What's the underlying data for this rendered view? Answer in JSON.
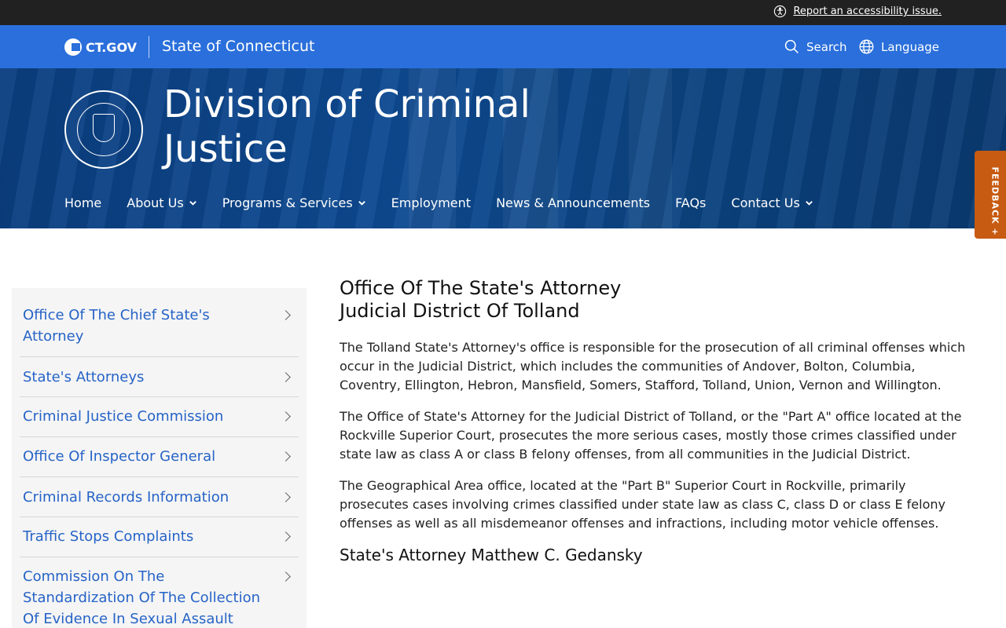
{
  "utility": {
    "accessibility_link": "Report an accessibility issue."
  },
  "ctbar": {
    "logo_text": "CT.GOV",
    "state_name": "State of Connecticut",
    "search_label": "Search",
    "language_label": "Language"
  },
  "hero": {
    "title_line1": "Division of Criminal",
    "title_line2": "Justice"
  },
  "nav": {
    "home": "Home",
    "about": "About Us",
    "programs": "Programs & Services",
    "employment": "Employment",
    "news": "News & Announcements",
    "faqs": "FAQs",
    "contact": "Contact Us"
  },
  "feedback": {
    "label": "FEEDBACK +"
  },
  "sidebar": {
    "items": [
      {
        "line1": "Office Of The Chief State's",
        "line2": "Attorney"
      },
      {
        "line1": "State's Attorneys"
      },
      {
        "line1": "Criminal Justice Commission"
      },
      {
        "line1": "Office Of Inspector General"
      },
      {
        "line1": "Criminal Records Information"
      },
      {
        "line1": "Traffic Stops Complaints"
      },
      {
        "line1": "Commission On The",
        "line2": "Standardization Of The Collection",
        "line3": "Of Evidence In Sexual Assault"
      }
    ]
  },
  "content": {
    "heading_line1": "Office Of The State's Attorney",
    "heading_line2": "Judicial District Of Tolland",
    "para1": "The Tolland State's Attorney's office is responsible for the prosecution of all criminal offenses which occur in the Judicial District, which includes the communities of Andover, Bolton, Columbia, Coventry, Ellington, Hebron, Mansfield, Somers, Stafford, Tolland, Union, Vernon and Willington.",
    "para2": "The Office of State's Attorney for the Judicial District of Tolland, or the \"Part A\" office located at the Rockville Superior Court, prosecutes the more serious cases, mostly those crimes classified under state law as class A or class B felony offenses, from all communities in the Judicial District.",
    "para3": "The Geographical Area office, located at the \"Part B\" Superior Court in Rockville, primarily prosecutes cases involving crimes classified under state law as class C, class D or class E felony offenses as well as all misdemeanor offenses and infractions, including motor vehicle offenses.",
    "subheading": "State's Attorney Matthew C. Gedansky"
  }
}
